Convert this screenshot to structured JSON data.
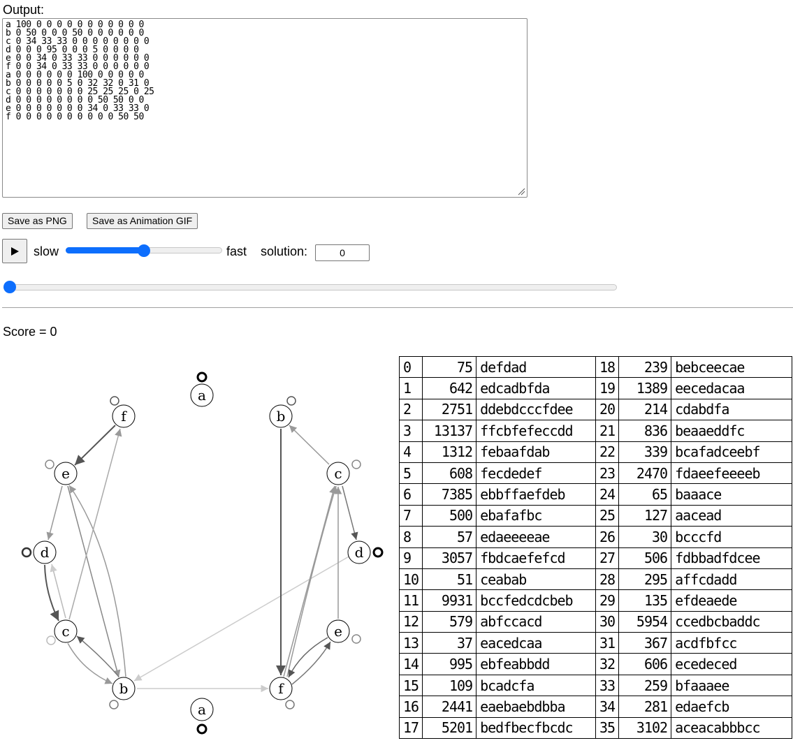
{
  "output": {
    "label": "Output:",
    "text": "a 100 0 0 0 0 0 0 0 0 0 0 0\nb 0 50 0 0 0 50 0 0 0 0 0 0\nc 0 34 33 33 0 0 0 0 0 0 0 0\nd 0 0 0 95 0 0 0 5 0 0 0 0\ne 0 0 34 0 33 33 0 0 0 0 0 0\nf 0 0 34 0 33 33 0 0 0 0 0 0\na 0 0 0 0 0 0 100 0 0 0 0 0\nb 0 0 0 0 0 5 0 32 32 0 31 0\nc 0 0 0 0 0 0 0 25 25 25 0 25\nd 0 0 0 0 0 0 0 0 50 50 0 0\ne 0 0 0 0 0 0 0 34 0 33 33 0\nf 0 0 0 0 0 0 0 0 0 0 50 50"
  },
  "buttons": {
    "save_png": "Save as PNG",
    "save_gif": "Save as Animation GIF"
  },
  "controls": {
    "play_icon": "play-icon",
    "slow_label": "slow",
    "fast_label": "fast",
    "speed_level": 0.5,
    "solution_label": "solution:",
    "solution_value": "0",
    "turn_position": 0
  },
  "score": {
    "label": "Score = ",
    "value": "0"
  },
  "graph": {
    "nodes": [
      {
        "label": "a"
      },
      {
        "label": "f"
      },
      {
        "label": "e"
      },
      {
        "label": "d"
      },
      {
        "label": "c"
      },
      {
        "label": "b"
      },
      {
        "label": "a"
      },
      {
        "label": "b"
      },
      {
        "label": "c"
      },
      {
        "label": "d"
      },
      {
        "label": "e"
      },
      {
        "label": "f"
      }
    ]
  },
  "table_left": [
    [
      "0",
      "75",
      "defdad"
    ],
    [
      "1",
      "642",
      "edcadbfda"
    ],
    [
      "2",
      "2751",
      "ddebdcccfdee"
    ],
    [
      "3",
      "13137",
      "ffcbfefeccdd"
    ],
    [
      "4",
      "1312",
      "febaafdab"
    ],
    [
      "5",
      "608",
      "fecdedef"
    ],
    [
      "6",
      "7385",
      "ebbffaefdeb"
    ],
    [
      "7",
      "500",
      "ebafafbc"
    ],
    [
      "8",
      "57",
      "edaeeeeae"
    ],
    [
      "9",
      "3057",
      "fbdcaefefcd"
    ],
    [
      "10",
      "51",
      "ceabab"
    ],
    [
      "11",
      "9931",
      "bccfedcdcbeb"
    ],
    [
      "12",
      "579",
      "abfccacd"
    ],
    [
      "13",
      "37",
      "eacedcaa"
    ],
    [
      "14",
      "995",
      "ebfeabbdd"
    ],
    [
      "15",
      "109",
      "bcadcfa"
    ],
    [
      "16",
      "2441",
      "eaebaebdbba"
    ],
    [
      "17",
      "5201",
      "bedfbecfbcdc"
    ]
  ],
  "table_right": [
    [
      "18",
      "239",
      "bebceecae"
    ],
    [
      "19",
      "1389",
      "eecedacaa"
    ],
    [
      "20",
      "214",
      "cdabdfa"
    ],
    [
      "21",
      "836",
      "beaaeddfc"
    ],
    [
      "22",
      "339",
      "bcafadceebf"
    ],
    [
      "23",
      "2470",
      "fdaeefeeeeb"
    ],
    [
      "24",
      "65",
      "baaace"
    ],
    [
      "25",
      "127",
      "aacead"
    ],
    [
      "26",
      "30",
      "bcccfd"
    ],
    [
      "27",
      "506",
      "fdbbadfdcee"
    ],
    [
      "28",
      "295",
      "affcdadd"
    ],
    [
      "29",
      "135",
      "efdeaede"
    ],
    [
      "30",
      "5954",
      "ccedbcbaddc"
    ],
    [
      "31",
      "367",
      "acdfbfcc"
    ],
    [
      "32",
      "606",
      "ecedeced"
    ],
    [
      "33",
      "259",
      "bfaaaee"
    ],
    [
      "34",
      "281",
      "edaefcb"
    ],
    [
      "35",
      "3102",
      "aceacabbbcc"
    ]
  ]
}
